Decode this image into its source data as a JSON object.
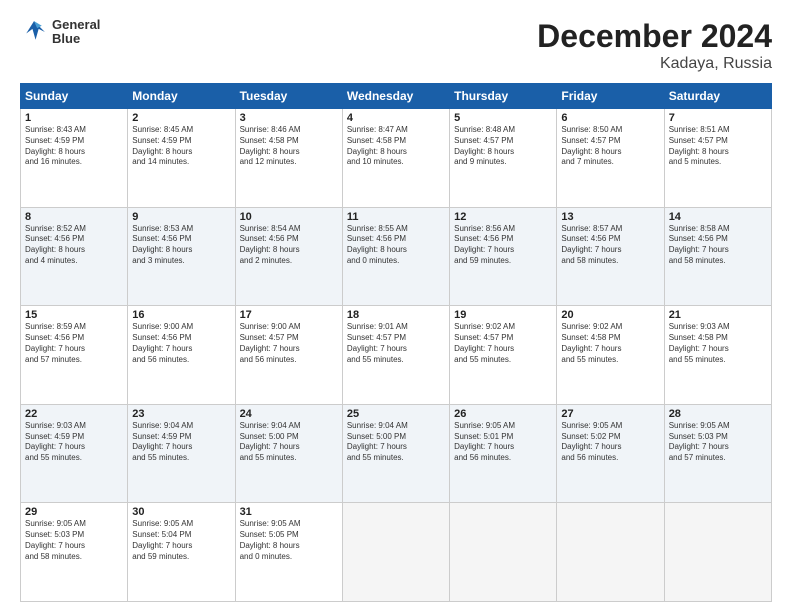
{
  "header": {
    "logo_line1": "General",
    "logo_line2": "Blue",
    "title": "December 2024",
    "subtitle": "Kadaya, Russia"
  },
  "weekdays": [
    "Sunday",
    "Monday",
    "Tuesday",
    "Wednesday",
    "Thursday",
    "Friday",
    "Saturday"
  ],
  "weeks": [
    [
      {
        "day": "1",
        "info": "Sunrise: 8:43 AM\nSunset: 4:59 PM\nDaylight: 8 hours\nand 16 minutes."
      },
      {
        "day": "2",
        "info": "Sunrise: 8:45 AM\nSunset: 4:59 PM\nDaylight: 8 hours\nand 14 minutes."
      },
      {
        "day": "3",
        "info": "Sunrise: 8:46 AM\nSunset: 4:58 PM\nDaylight: 8 hours\nand 12 minutes."
      },
      {
        "day": "4",
        "info": "Sunrise: 8:47 AM\nSunset: 4:58 PM\nDaylight: 8 hours\nand 10 minutes."
      },
      {
        "day": "5",
        "info": "Sunrise: 8:48 AM\nSunset: 4:57 PM\nDaylight: 8 hours\nand 9 minutes."
      },
      {
        "day": "6",
        "info": "Sunrise: 8:50 AM\nSunset: 4:57 PM\nDaylight: 8 hours\nand 7 minutes."
      },
      {
        "day": "7",
        "info": "Sunrise: 8:51 AM\nSunset: 4:57 PM\nDaylight: 8 hours\nand 5 minutes."
      }
    ],
    [
      {
        "day": "8",
        "info": "Sunrise: 8:52 AM\nSunset: 4:56 PM\nDaylight: 8 hours\nand 4 minutes."
      },
      {
        "day": "9",
        "info": "Sunrise: 8:53 AM\nSunset: 4:56 PM\nDaylight: 8 hours\nand 3 minutes."
      },
      {
        "day": "10",
        "info": "Sunrise: 8:54 AM\nSunset: 4:56 PM\nDaylight: 8 hours\nand 2 minutes."
      },
      {
        "day": "11",
        "info": "Sunrise: 8:55 AM\nSunset: 4:56 PM\nDaylight: 8 hours\nand 0 minutes."
      },
      {
        "day": "12",
        "info": "Sunrise: 8:56 AM\nSunset: 4:56 PM\nDaylight: 7 hours\nand 59 minutes."
      },
      {
        "day": "13",
        "info": "Sunrise: 8:57 AM\nSunset: 4:56 PM\nDaylight: 7 hours\nand 58 minutes."
      },
      {
        "day": "14",
        "info": "Sunrise: 8:58 AM\nSunset: 4:56 PM\nDaylight: 7 hours\nand 58 minutes."
      }
    ],
    [
      {
        "day": "15",
        "info": "Sunrise: 8:59 AM\nSunset: 4:56 PM\nDaylight: 7 hours\nand 57 minutes."
      },
      {
        "day": "16",
        "info": "Sunrise: 9:00 AM\nSunset: 4:56 PM\nDaylight: 7 hours\nand 56 minutes."
      },
      {
        "day": "17",
        "info": "Sunrise: 9:00 AM\nSunset: 4:57 PM\nDaylight: 7 hours\nand 56 minutes."
      },
      {
        "day": "18",
        "info": "Sunrise: 9:01 AM\nSunset: 4:57 PM\nDaylight: 7 hours\nand 55 minutes."
      },
      {
        "day": "19",
        "info": "Sunrise: 9:02 AM\nSunset: 4:57 PM\nDaylight: 7 hours\nand 55 minutes."
      },
      {
        "day": "20",
        "info": "Sunrise: 9:02 AM\nSunset: 4:58 PM\nDaylight: 7 hours\nand 55 minutes."
      },
      {
        "day": "21",
        "info": "Sunrise: 9:03 AM\nSunset: 4:58 PM\nDaylight: 7 hours\nand 55 minutes."
      }
    ],
    [
      {
        "day": "22",
        "info": "Sunrise: 9:03 AM\nSunset: 4:59 PM\nDaylight: 7 hours\nand 55 minutes."
      },
      {
        "day": "23",
        "info": "Sunrise: 9:04 AM\nSunset: 4:59 PM\nDaylight: 7 hours\nand 55 minutes."
      },
      {
        "day": "24",
        "info": "Sunrise: 9:04 AM\nSunset: 5:00 PM\nDaylight: 7 hours\nand 55 minutes."
      },
      {
        "day": "25",
        "info": "Sunrise: 9:04 AM\nSunset: 5:00 PM\nDaylight: 7 hours\nand 55 minutes."
      },
      {
        "day": "26",
        "info": "Sunrise: 9:05 AM\nSunset: 5:01 PM\nDaylight: 7 hours\nand 56 minutes."
      },
      {
        "day": "27",
        "info": "Sunrise: 9:05 AM\nSunset: 5:02 PM\nDaylight: 7 hours\nand 56 minutes."
      },
      {
        "day": "28",
        "info": "Sunrise: 9:05 AM\nSunset: 5:03 PM\nDaylight: 7 hours\nand 57 minutes."
      }
    ],
    [
      {
        "day": "29",
        "info": "Sunrise: 9:05 AM\nSunset: 5:03 PM\nDaylight: 7 hours\nand 58 minutes."
      },
      {
        "day": "30",
        "info": "Sunrise: 9:05 AM\nSunset: 5:04 PM\nDaylight: 7 hours\nand 59 minutes."
      },
      {
        "day": "31",
        "info": "Sunrise: 9:05 AM\nSunset: 5:05 PM\nDaylight: 8 hours\nand 0 minutes."
      },
      null,
      null,
      null,
      null
    ]
  ]
}
